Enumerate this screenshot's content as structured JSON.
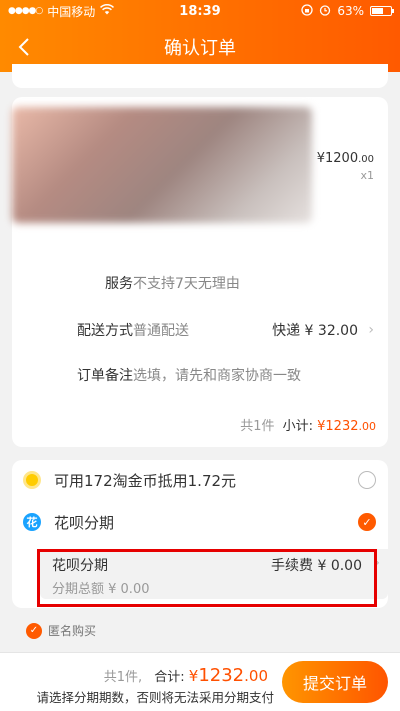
{
  "status_bar": {
    "signal": "●●●●○",
    "carrier": "中国移动",
    "wifi": "wifi-icon",
    "time": "18:39",
    "battery_percent": "63%",
    "battery_level": 0.63
  },
  "nav": {
    "title": "确认订单",
    "back_icon": "chevron-left-icon"
  },
  "product": {
    "price": "¥1200",
    "price_decimal": ".00",
    "quantity": "x1"
  },
  "order_rows": {
    "service": {
      "label": "服务",
      "value": "不支持7天无理由"
    },
    "delivery": {
      "label": "配送方式",
      "value": "普通配送",
      "right": "快递 ¥ 32.00"
    },
    "note": {
      "label": "订单备注",
      "placeholder": "选填，请先和商家协商一致"
    }
  },
  "subtotal": {
    "count": "共1件",
    "label": "小计:",
    "amount": "¥1232",
    "decimal": ".00"
  },
  "payment": {
    "coins": {
      "text": "可用172淘金币抵用1.72元",
      "selected": false
    },
    "huabei": {
      "text": "花呗分期",
      "selected": true
    },
    "installment": {
      "title": "花呗分期",
      "fee": "手续费 ¥ 0.00",
      "total": "分期总额 ¥ 0.00"
    }
  },
  "anonymous": {
    "label": "匿名购买",
    "checked": true
  },
  "footer": {
    "count": "共1件,",
    "total_label": "合计:",
    "total_currency": "¥",
    "total_int": "1232",
    "total_dec": ".00",
    "hint": "请选择分期期数，否则将无法采用分期支付",
    "submit": "提交订单"
  },
  "colors": {
    "accent": "#ff5a00",
    "highlight_box": "#e60000"
  }
}
